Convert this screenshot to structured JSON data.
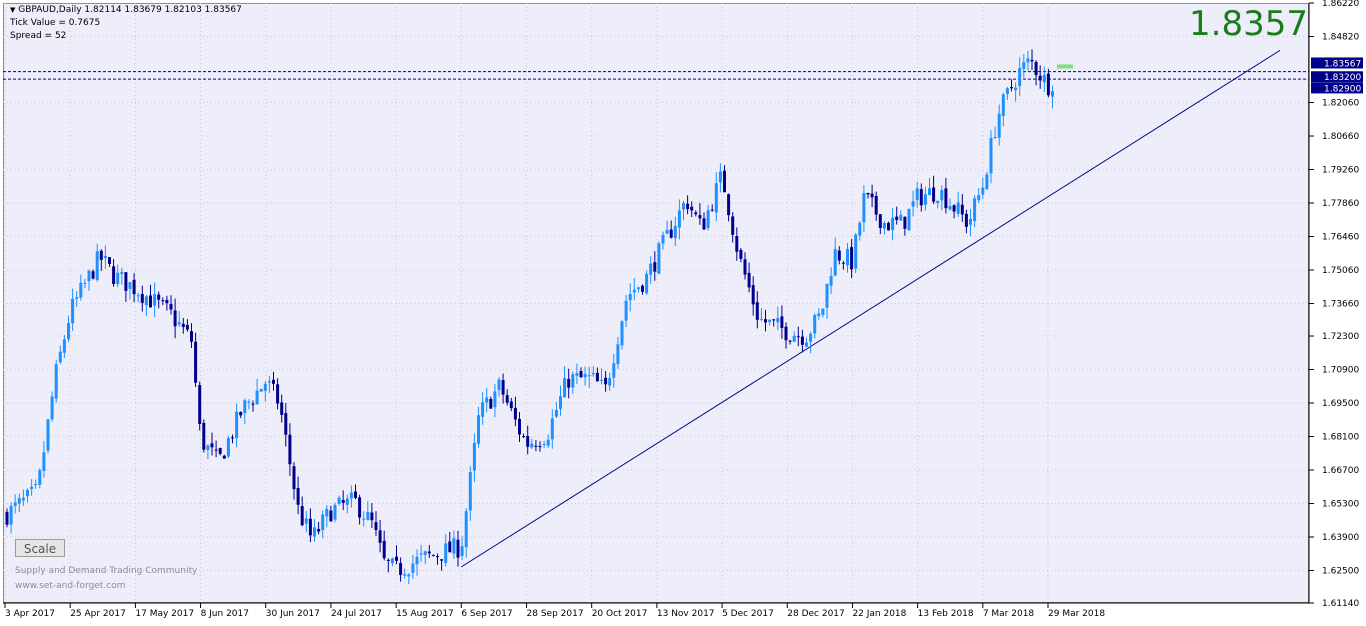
{
  "header": {
    "symbol_line": "GBPAUD,Daily  1.82114 1.83679 1.82103 1.83567",
    "tick_value": "Tick Value = 0.7675",
    "spread": "Spread = 52"
  },
  "current_price_big": "1.8357",
  "scale_button": "Scale",
  "watermark": {
    "line1": "Supply and Demand Trading Community",
    "line2": "www.set-and-forget.com"
  },
  "price_tags": {
    "bid": "1.83567",
    "ask": "1.83200",
    "line": "1.82900"
  },
  "colors": {
    "background": "#eeeefa",
    "bull_candle": "#1e90ff",
    "bear_candle": "#00008b",
    "trendline": "#00008b",
    "big_price": "#1a7c1a",
    "price_tag_bg": "#00008b"
  },
  "chart_data": {
    "type": "candlestick",
    "title": "GBPAUD,Daily",
    "y_ticks": [
      "1.86220",
      "1.84820",
      "1.83567",
      "1.83200",
      "1.82900",
      "1.82060",
      "1.80660",
      "1.79260",
      "1.77860",
      "1.76460",
      "1.75060",
      "1.73660",
      "1.72300",
      "1.70900",
      "1.69500",
      "1.68100",
      "1.66700",
      "1.65300",
      "1.63900",
      "1.62500",
      "1.61140"
    ],
    "x_ticks": [
      "3 Apr 2017",
      "25 Apr 2017",
      "17 May 2017",
      "8 Jun 2017",
      "30 Jun 2017",
      "24 Jul 2017",
      "15 Aug 2017",
      "6 Sep 2017",
      "28 Sep 2017",
      "20 Oct 2017",
      "13 Nov 2017",
      "5 Dec 2017",
      "28 Dec 2017",
      "22 Jan 2018",
      "13 Feb 2018",
      "7 Mar 2018",
      "29 Mar 2018"
    ],
    "ylim": [
      1.6114,
      1.8622
    ],
    "horizontal_lines": [
      1.8335,
      1.8304
    ],
    "trendline": [
      {
        "date": "6 Sep 2017",
        "price": 1.6265
      },
      {
        "date": "end",
        "price": 1.8424
      }
    ],
    "close_path": [
      [
        "3 Apr 2017",
        1.648
      ],
      [
        "14 Apr 2017",
        1.658
      ],
      [
        "20 Apr 2017",
        1.706
      ],
      [
        "25 Apr 2017",
        1.733
      ],
      [
        "5 May 2017",
        1.756
      ],
      [
        "10 May 2017",
        1.748
      ],
      [
        "17 May 2017",
        1.743
      ],
      [
        "29 May 2017",
        1.732
      ],
      [
        "5 Jun 2017",
        1.721
      ],
      [
        "8 Jun 2017",
        1.68
      ],
      [
        "14 Jun 2017",
        1.67
      ],
      [
        "22 Jun 2017",
        1.692
      ],
      [
        "30 Jun 2017",
        1.704
      ],
      [
        "5 Jul 2017",
        1.695
      ],
      [
        "12 Jul 2017",
        1.65
      ],
      [
        "17 Jul 2017",
        1.638
      ],
      [
        "24 Jul 2017",
        1.65
      ],
      [
        "1 Aug 2017",
        1.654
      ],
      [
        "7 Aug 2017",
        1.644
      ],
      [
        "11 Aug 2017",
        1.628
      ],
      [
        "15 Aug 2017",
        1.625
      ],
      [
        "24 Aug 2017",
        1.63
      ],
      [
        "6 Sep 2017",
        1.635
      ],
      [
        "12 Sep 2017",
        1.69
      ],
      [
        "19 Sep 2017",
        1.702
      ],
      [
        "25 Sep 2017",
        1.685
      ],
      [
        "28 Sep 2017",
        1.678
      ],
      [
        "5 Oct 2017",
        1.682
      ],
      [
        "12 Oct 2017",
        1.705
      ],
      [
        "20 Oct 2017",
        1.705
      ],
      [
        "25 Oct 2017",
        1.7
      ],
      [
        "2 Nov 2017",
        1.74
      ],
      [
        "9 Nov 2017",
        1.747
      ],
      [
        "13 Nov 2017",
        1.756
      ],
      [
        "23 Nov 2017",
        1.78
      ],
      [
        "28 Nov 2017",
        1.768
      ],
      [
        "5 Dec 2017",
        1.79
      ],
      [
        "11 Dec 2017",
        1.756
      ],
      [
        "18 Dec 2017",
        1.73
      ],
      [
        "28 Dec 2017",
        1.725
      ],
      [
        "4 Jan 2018",
        1.723
      ],
      [
        "10 Jan 2018",
        1.732
      ],
      [
        "15 Jan 2018",
        1.758
      ],
      [
        "22 Jan 2018",
        1.754
      ],
      [
        "26 Jan 2018",
        1.781
      ],
      [
        "2 Feb 2018",
        1.77
      ],
      [
        "8 Feb 2018",
        1.77
      ],
      [
        "13 Feb 2018",
        1.781
      ],
      [
        "20 Feb 2018",
        1.784
      ],
      [
        "26 Feb 2018",
        1.776
      ],
      [
        "2 Mar 2018",
        1.77
      ],
      [
        "7 Mar 2018",
        1.786
      ],
      [
        "12 Mar 2018",
        1.815
      ],
      [
        "19 Mar 2018",
        1.833
      ],
      [
        "23 Mar 2018",
        1.838
      ],
      [
        "29 Mar 2018",
        1.828
      ],
      [
        "5 Apr 2018",
        1.8357
      ]
    ]
  }
}
